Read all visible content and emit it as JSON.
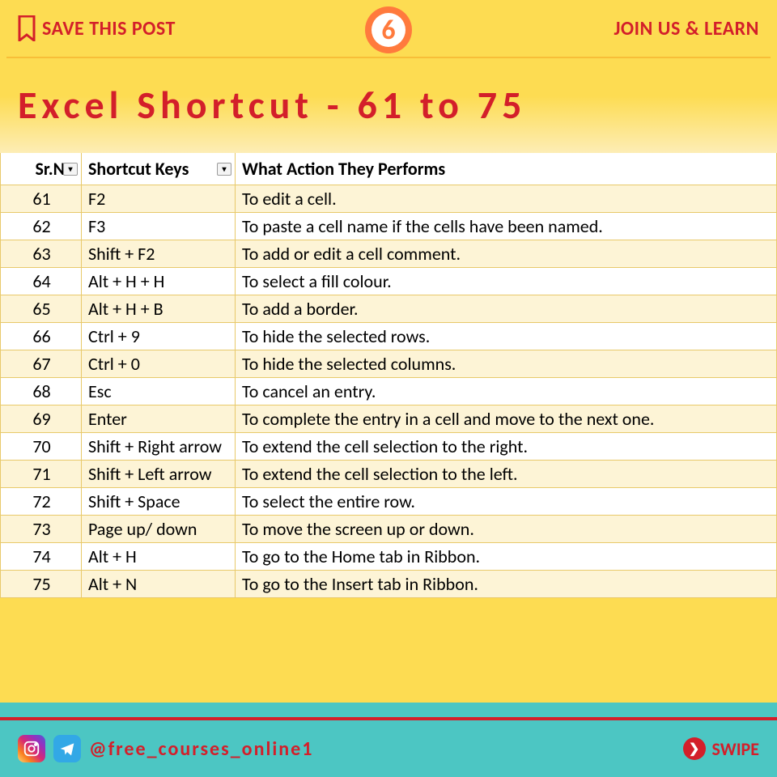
{
  "header": {
    "save_label": "SAVE THIS POST",
    "join_label": "JOIN US & LEARN",
    "page_badge": "6"
  },
  "title": "Excel Shortcut - 61 to 75",
  "table": {
    "columns": {
      "srno": "Sr.No",
      "keys": "Shortcut Keys",
      "action": "What Action They Performs"
    },
    "rows": [
      {
        "srno": "61",
        "keys": "F2",
        "action": "To edit a cell."
      },
      {
        "srno": "62",
        "keys": "F3",
        "action": "To paste a cell name if the cells have been named."
      },
      {
        "srno": "63",
        "keys": "Shift + F2",
        "action": "To add or edit a cell comment."
      },
      {
        "srno": "64",
        "keys": "Alt + H + H",
        "action": "To select a fill colour."
      },
      {
        "srno": "65",
        "keys": "Alt + H + B",
        "action": "To add a border."
      },
      {
        "srno": "66",
        "keys": "Ctrl + 9",
        "action": "To hide the selected rows."
      },
      {
        "srno": "67",
        "keys": "Ctrl + 0",
        "action": "To hide the selected columns."
      },
      {
        "srno": "68",
        "keys": "Esc",
        "action": "To cancel an entry."
      },
      {
        "srno": "69",
        "keys": "Enter",
        "action": "To complete the entry in a cell and move to the next one."
      },
      {
        "srno": "70",
        "keys": "Shift + Right arrow",
        "action": "To extend the cell selection to the right."
      },
      {
        "srno": "71",
        "keys": "Shift + Left arrow",
        "action": "To extend the cell selection to the left."
      },
      {
        "srno": "72",
        "keys": "Shift + Space",
        "action": "To select the entire row."
      },
      {
        "srno": "73",
        "keys": "Page up/ down",
        "action": "To move the screen up or down."
      },
      {
        "srno": "74",
        "keys": "Alt + H",
        "action": "To go to the Home tab in Ribbon."
      },
      {
        "srno": "75",
        "keys": "Alt + N",
        "action": "To go to the Insert tab in Ribbon."
      }
    ]
  },
  "footer": {
    "handle": "@free_courses_online1",
    "swipe": "SWIPE"
  }
}
